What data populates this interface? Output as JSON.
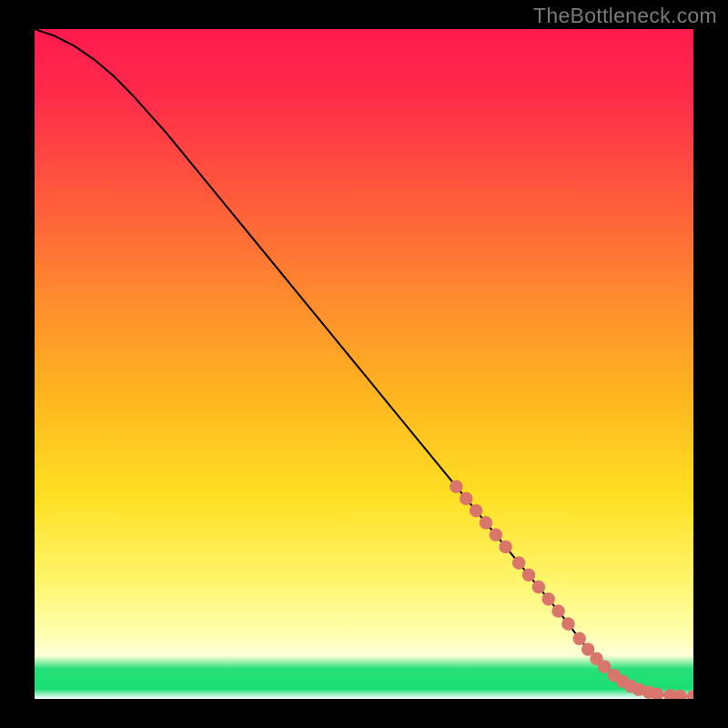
{
  "watermark": "TheBottleneck.com",
  "colors": {
    "gradient_stops": [
      {
        "offset": 0.0,
        "color": "#ff1a4d"
      },
      {
        "offset": 0.1,
        "color": "#ff2b4a"
      },
      {
        "offset": 0.25,
        "color": "#ff5a3c"
      },
      {
        "offset": 0.4,
        "color": "#ff8a2e"
      },
      {
        "offset": 0.55,
        "color": "#ffb61f"
      },
      {
        "offset": 0.7,
        "color": "#ffe023"
      },
      {
        "offset": 0.82,
        "color": "#fff56a"
      },
      {
        "offset": 0.9,
        "color": "#ffffad"
      },
      {
        "offset": 0.935,
        "color": "#ffffd9"
      },
      {
        "offset": 0.955,
        "color": "#27e07a"
      },
      {
        "offset": 0.985,
        "color": "#1adf73"
      },
      {
        "offset": 1.0,
        "color": "#ffffff"
      }
    ],
    "curve_stroke": "#000000",
    "marker_fill": "#d9756b",
    "marker_stroke": "#c06058"
  },
  "chart_data": {
    "type": "line",
    "title": "",
    "xlabel": "",
    "ylabel": "",
    "xlim": [
      0,
      100
    ],
    "ylim": [
      0,
      100
    ],
    "grid": false,
    "legend_position": "none",
    "series": [
      {
        "name": "curve",
        "x": [
          0,
          3,
          6,
          9,
          12,
          15,
          20,
          25,
          30,
          35,
          40,
          45,
          50,
          55,
          60,
          65,
          70,
          75,
          80,
          83,
          85,
          87,
          89,
          91,
          93,
          95,
          97,
          99,
          100
        ],
        "y": [
          100,
          99,
          97.5,
          95.5,
          93,
          90,
          84.5,
          78.5,
          72.5,
          66.5,
          60.5,
          54.5,
          48.5,
          42.5,
          36.5,
          30.5,
          24.5,
          18.5,
          12.5,
          8.6,
          6.3,
          4.3,
          2.8,
          1.7,
          1.0,
          0.6,
          0.4,
          0.35,
          0.35
        ]
      }
    ],
    "markers": [
      {
        "x": 64.0,
        "y": 31.7
      },
      {
        "x": 65.5,
        "y": 29.9
      },
      {
        "x": 67.0,
        "y": 28.1
      },
      {
        "x": 68.5,
        "y": 26.3
      },
      {
        "x": 70.0,
        "y": 24.5
      },
      {
        "x": 71.5,
        "y": 22.7
      },
      {
        "x": 73.5,
        "y": 20.3
      },
      {
        "x": 75.0,
        "y": 18.5
      },
      {
        "x": 76.5,
        "y": 16.7
      },
      {
        "x": 78.0,
        "y": 14.9
      },
      {
        "x": 79.5,
        "y": 13.1
      },
      {
        "x": 81.0,
        "y": 11.2
      },
      {
        "x": 82.7,
        "y": 9.0
      },
      {
        "x": 84.0,
        "y": 7.4
      },
      {
        "x": 85.3,
        "y": 6.0
      },
      {
        "x": 86.5,
        "y": 4.8
      },
      {
        "x": 88.0,
        "y": 3.5
      },
      {
        "x": 89.3,
        "y": 2.6
      },
      {
        "x": 90.5,
        "y": 1.9
      },
      {
        "x": 91.7,
        "y": 1.4
      },
      {
        "x": 93.2,
        "y": 1.0
      },
      {
        "x": 94.5,
        "y": 0.7
      },
      {
        "x": 96.5,
        "y": 0.5
      },
      {
        "x": 98.0,
        "y": 0.4
      },
      {
        "x": 100.0,
        "y": 0.35
      }
    ],
    "annotations": []
  }
}
